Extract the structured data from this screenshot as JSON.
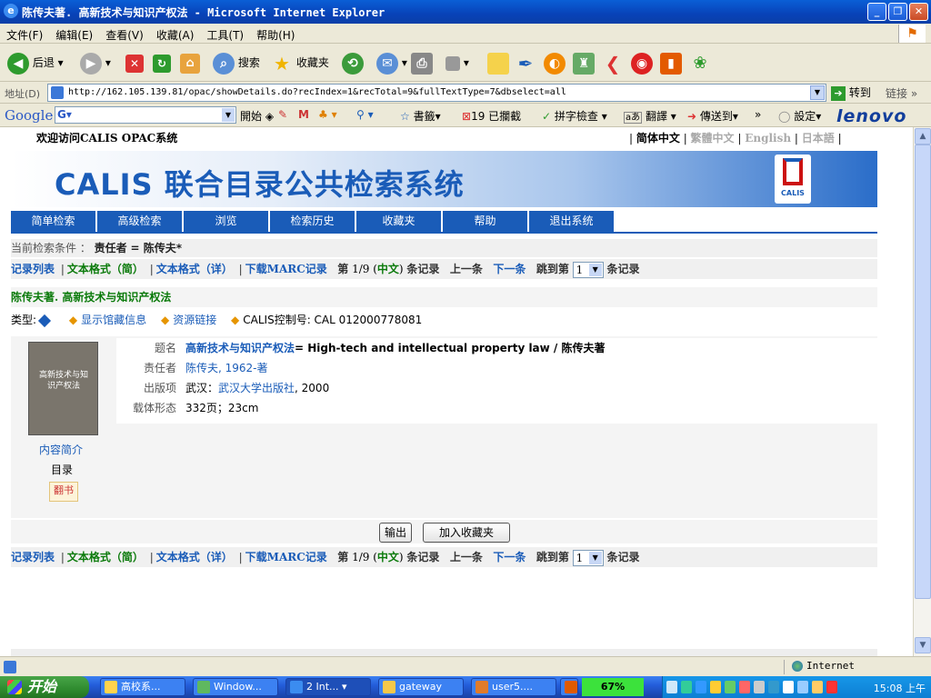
{
  "window": {
    "title": "陈传夫著. 高新技术与知识产权法 - Microsoft Internet Explorer",
    "min": "_",
    "max": "❐",
    "close": "✕"
  },
  "menubar": [
    "文件(F)",
    "编辑(E)",
    "查看(V)",
    "收藏(A)",
    "工具(T)",
    "帮助(H)"
  ],
  "toolbar": {
    "back": "后退",
    "search": "搜索",
    "favorites": "收藏夹"
  },
  "address": {
    "label": "地址(D)",
    "url": "http://162.105.139.81/opac/showDetails.do?recIndex=1&recTotal=9&fullTextType=7&dbselect=all",
    "go": "转到",
    "links": "链接"
  },
  "googlebar": {
    "logo": "Google",
    "start": "開始",
    "bookmarks": "書籤",
    "blocked": "19 已攔截",
    "spell": "拼字檢查",
    "translate": "翻譯",
    "send": "傳送到",
    "settings": "設定",
    "brand": "lenovo"
  },
  "page": {
    "welcome": "欢迎访问CALIS OPAC系统",
    "langs": {
      "simplified": "简体中文",
      "traditional": "繁體中文",
      "english": "English",
      "japanese": "日本語"
    },
    "banner_title": "CALIS 联合目录公共检索系统",
    "banner_logo": "CALIS",
    "nav": [
      "简单检索",
      "高级检索",
      "浏览",
      "检索历史",
      "收藏夹",
      "帮助",
      "退出系统"
    ],
    "condition_prefix": "当前检索条件 ：",
    "condition_field": "责任者",
    "condition_value": "= 陈传夫*",
    "recnav": {
      "list": "记录列表",
      "brief": "文本格式（简）",
      "full": "文本格式（详）",
      "marc": "下载MARC记录",
      "di": "第",
      "position": "1/9",
      "lang": "中文",
      "tiao": "条记录",
      "prev": "上一条",
      "next": "下一条",
      "jump": "跳到第",
      "jump_value": "1",
      "jump_suffix": "条记录"
    },
    "book_heading": "陈传夫著. 高新技术与知识产权法",
    "type_label": "类型:",
    "holdings": "显示馆藏信息",
    "resources": "资源链接",
    "control_no": "CALIS控制号: CAL 012000778081",
    "cover_text": "高新技术与知识产权法",
    "cover_links": {
      "summary": "内容简介",
      "toc": "目录",
      "flip": "翻书"
    },
    "fields": [
      {
        "label": "题名",
        "value_link": "高新技术与知识产权法",
        "value_rest": "= High-tech and intellectual property law / 陈传夫著"
      },
      {
        "label": "责任者",
        "value_link": "陈传夫, 1962-著",
        "value_rest": ""
      },
      {
        "label": "出版项",
        "value_prefix": "武汉：",
        "value_link": "武汉大学出版社",
        "value_rest": ", 2000"
      },
      {
        "label": "载体形态",
        "value_rest": "332页；23cm"
      }
    ],
    "buttons": {
      "export": "输出",
      "add_fav": "加入收藏夹"
    }
  },
  "statusbar": {
    "zone": "Internet"
  },
  "taskbar": {
    "start": "开始",
    "tasks": [
      "高校系...",
      "Window...",
      "2 Int...",
      "gateway",
      "user5...."
    ],
    "percent": "67%",
    "clock": "15:08 上午"
  }
}
